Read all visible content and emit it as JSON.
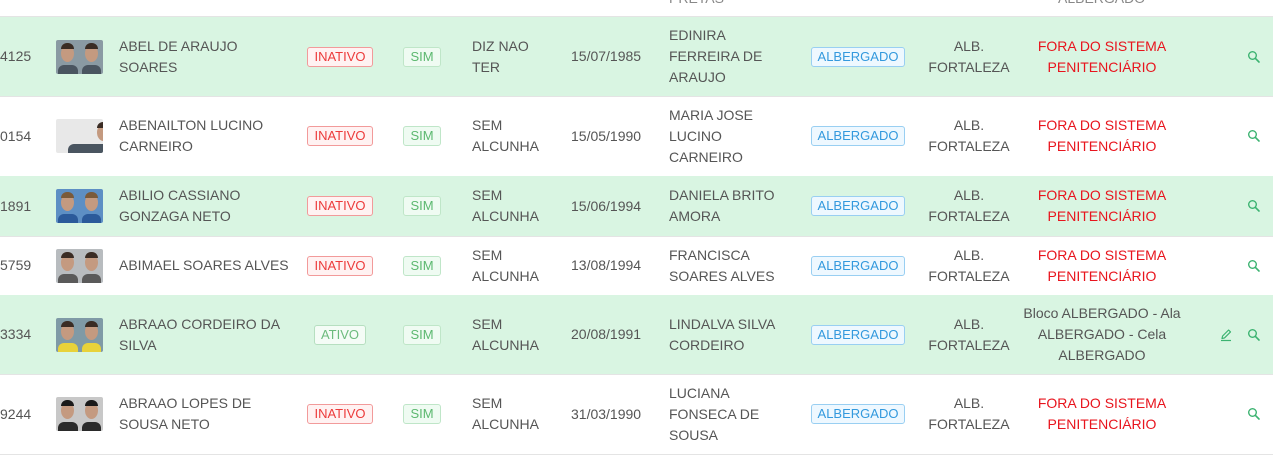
{
  "top_fragment": {
    "col7": "PRETAS",
    "col11": "ALBERGADO"
  },
  "rows": [
    {
      "id": "4125",
      "name": "ABEL DE ARAUJO SOARES",
      "status": "INATIVO",
      "flag": "SIM",
      "alias": "DIZ NAO TER",
      "birth_date": "15/07/1985",
      "mother": "EDINIRA FERREIRA DE ARAUJO",
      "regime": "ALBERGADO",
      "unit": "ALB. FORTALEZA",
      "location": "FORA DO SISTEMA PENITENCIÁRIO"
    },
    {
      "id": "0154",
      "name": "ABENAILTON LUCINO CARNEIRO",
      "status": "INATIVO",
      "flag": "SIM",
      "alias": "SEM ALCUNHA",
      "birth_date": "15/05/1990",
      "mother": "MARIA JOSE LUCINO CARNEIRO",
      "regime": "ALBERGADO",
      "unit": "ALB. FORTALEZA",
      "location": "FORA DO SISTEMA PENITENCIÁRIO"
    },
    {
      "id": "1891",
      "name": "ABILIO CASSIANO GONZAGA NETO",
      "status": "INATIVO",
      "flag": "SIM",
      "alias": "SEM ALCUNHA",
      "birth_date": "15/06/1994",
      "mother": "DANIELA BRITO AMORA",
      "regime": "ALBERGADO",
      "unit": "ALB. FORTALEZA",
      "location": "FORA DO SISTEMA PENITENCIÁRIO"
    },
    {
      "id": "5759",
      "name": "ABIMAEL SOARES ALVES",
      "status": "INATIVO",
      "flag": "SIM",
      "alias": "SEM ALCUNHA",
      "birth_date": "13/08/1994",
      "mother": "FRANCISCA SOARES ALVES",
      "regime": "ALBERGADO",
      "unit": "ALB. FORTALEZA",
      "location": "FORA DO SISTEMA PENITENCIÁRIO"
    },
    {
      "id": "3334",
      "name": "ABRAAO CORDEIRO DA SILVA",
      "status": "ATIVO",
      "flag": "SIM",
      "alias": "SEM ALCUNHA",
      "birth_date": "20/08/1991",
      "mother": "LINDALVA SILVA CORDEIRO",
      "regime": "ALBERGADO",
      "unit": "ALB. FORTALEZA",
      "location": "Bloco ALBERGADO - Ala ALBERGADO - Cela ALBERGADO"
    },
    {
      "id": "9244",
      "name": "ABRAAO LOPES DE SOUSA NETO",
      "status": "INATIVO",
      "flag": "SIM",
      "alias": "SEM ALCUNHA",
      "birth_date": "31/03/1990",
      "mother": "LUCIANA FONSECA DE SOUSA",
      "regime": "ALBERGADO",
      "unit": "ALB. FORTALEZA",
      "location": "FORA DO SISTEMA PENITENCIÁRIO"
    }
  ],
  "colors": {
    "row_alt_bg": "#d9f5e2",
    "inactive_red": "#ec3b3b",
    "active_green": "#6dbb7d",
    "regime_blue": "#3399dd",
    "location_red": "#e8141d",
    "action_green": "#3cb371"
  },
  "icons": {
    "edit": "pencil-icon",
    "view": "search-icon"
  }
}
